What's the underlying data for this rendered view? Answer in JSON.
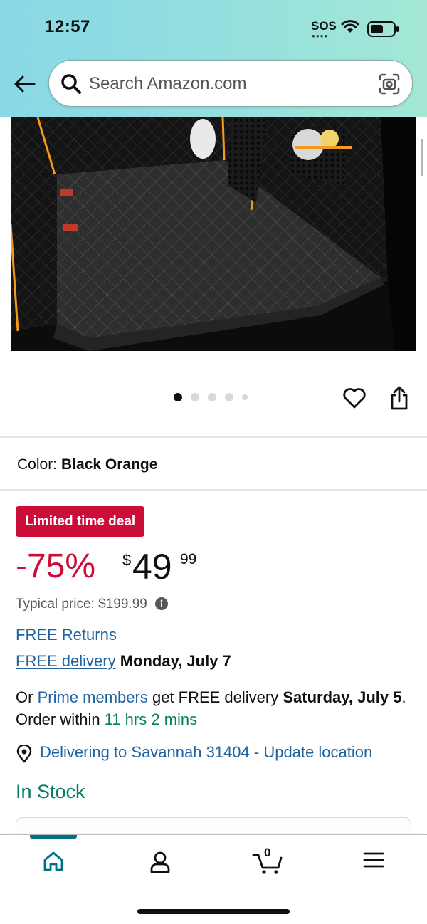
{
  "status_bar": {
    "time": "12:57",
    "sos": "SOS"
  },
  "search": {
    "placeholder": "Search Amazon.com"
  },
  "gallery": {
    "image_count": 5,
    "active_index": 0
  },
  "color": {
    "label": "Color:",
    "value": "Black Orange"
  },
  "deal": {
    "badge": "Limited time deal"
  },
  "price": {
    "discount": "-75%",
    "symbol": "$",
    "whole": "49",
    "fraction": "99",
    "typical_label": "Typical price:",
    "typical_value": "$199.99"
  },
  "shipping": {
    "free_returns": "FREE Returns",
    "free_delivery_link": "FREE delivery",
    "delivery_date": "Monday, July 7",
    "prime_prefix": "Or",
    "prime_link": "Prime members",
    "prime_mid": "get FREE delivery",
    "prime_date": "Saturday, July 5",
    "order_within": ". Order within",
    "countdown": "11 hrs 2 mins"
  },
  "location": {
    "text": "Delivering to Savannah 31404 - Update location"
  },
  "stock": {
    "status": "In Stock"
  },
  "nav": {
    "cart_count": "0",
    "active": "home"
  },
  "colors": {
    "deal_red": "#cc0c39",
    "link_blue": "#2162a1",
    "stock_green": "#067d62",
    "nav_teal": "#007185"
  }
}
